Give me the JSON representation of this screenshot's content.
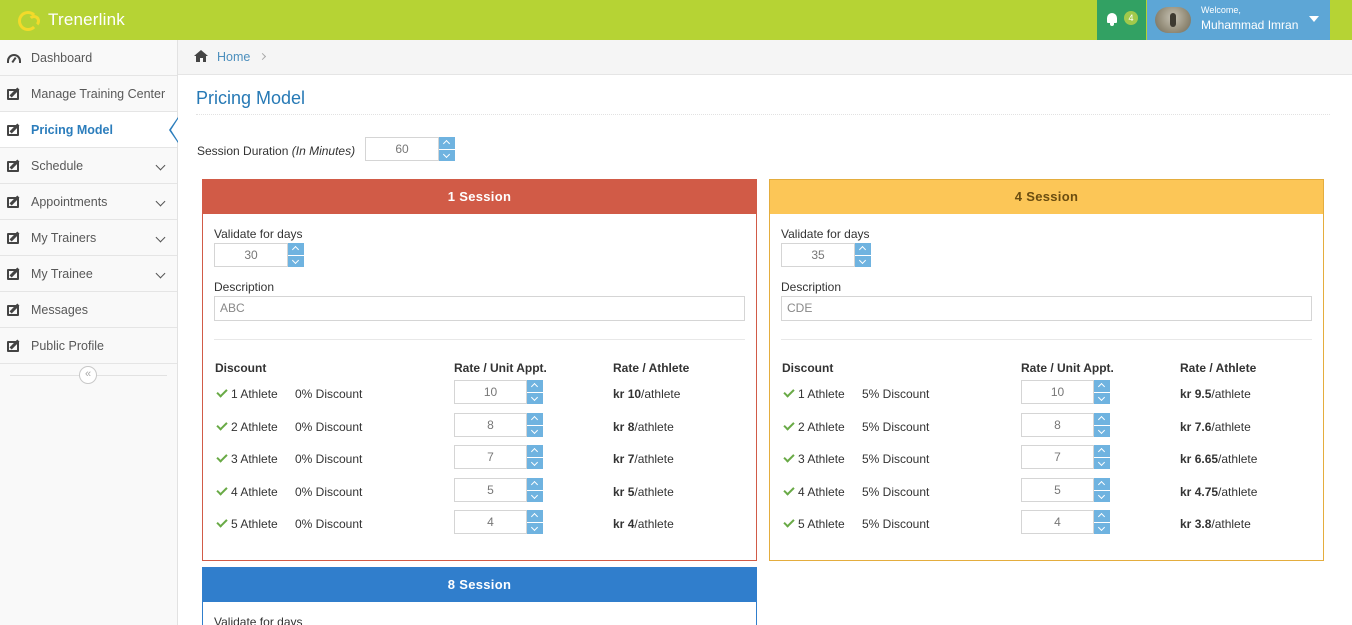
{
  "header": {
    "brand": "Trenerlink",
    "notification_count": "4",
    "welcome": "Welcome,",
    "user_name": "Muhammad Imran"
  },
  "sidebar": {
    "items": [
      {
        "label": "Dashboard",
        "icon": "dashboard-icon",
        "has_children": false,
        "active": false
      },
      {
        "label": "Manage Training Center",
        "icon": "edit-icon",
        "has_children": false,
        "active": false
      },
      {
        "label": "Pricing Model",
        "icon": "edit-icon",
        "has_children": false,
        "active": true
      },
      {
        "label": "Schedule",
        "icon": "edit-icon",
        "has_children": true,
        "active": false
      },
      {
        "label": "Appointments",
        "icon": "edit-icon",
        "has_children": true,
        "active": false
      },
      {
        "label": "My Trainers",
        "icon": "edit-icon",
        "has_children": true,
        "active": false
      },
      {
        "label": "My Trainee",
        "icon": "edit-icon",
        "has_children": true,
        "active": false
      },
      {
        "label": "Messages",
        "icon": "edit-icon",
        "has_children": false,
        "active": false
      },
      {
        "label": "Public Profile",
        "icon": "edit-icon",
        "has_children": false,
        "active": false
      }
    ],
    "collapse_glyph": "«"
  },
  "breadcrumb": {
    "home": "Home"
  },
  "page": {
    "title": "Pricing Model",
    "session_duration_label": "Session Duration",
    "session_duration_unit": "(In Minutes)",
    "session_duration_value": "60"
  },
  "colors": {
    "header_bg": "#b6d334",
    "notif_bg": "#32a163",
    "user_bg": "#5da6d6",
    "accent": "#2b7dbc",
    "panel_red": "#d15b47",
    "panel_yellow": "#fcc657",
    "panel_blue": "#307ecc"
  },
  "labels": {
    "validate": "Validate for days",
    "description": "Description",
    "discount": "Discount",
    "rate_unit": "Rate / Unit Appt.",
    "rate_athlete": "Rate / Athlete",
    "currency": "kr",
    "per_athlete": "/athlete"
  },
  "packages": [
    {
      "title": "1 Session",
      "validate_days": "30",
      "description": "ABC",
      "rows": [
        {
          "athletes": "1 Athlete",
          "discount": "0% Discount",
          "rate_unit": "10",
          "rate_athlete": "10"
        },
        {
          "athletes": "2 Athlete",
          "discount": "0% Discount",
          "rate_unit": "8",
          "rate_athlete": "8"
        },
        {
          "athletes": "3 Athlete",
          "discount": "0% Discount",
          "rate_unit": "7",
          "rate_athlete": "7"
        },
        {
          "athletes": "4 Athlete",
          "discount": "0% Discount",
          "rate_unit": "5",
          "rate_athlete": "5"
        },
        {
          "athletes": "5 Athlete",
          "discount": "0% Discount",
          "rate_unit": "4",
          "rate_athlete": "4"
        }
      ]
    },
    {
      "title": "4 Session",
      "validate_days": "35",
      "description": "CDE",
      "rows": [
        {
          "athletes": "1 Athlete",
          "discount": "5% Discount",
          "rate_unit": "10",
          "rate_athlete": "9.5"
        },
        {
          "athletes": "2 Athlete",
          "discount": "5% Discount",
          "rate_unit": "8",
          "rate_athlete": "7.6"
        },
        {
          "athletes": "3 Athlete",
          "discount": "5% Discount",
          "rate_unit": "7",
          "rate_athlete": "6.65"
        },
        {
          "athletes": "4 Athlete",
          "discount": "5% Discount",
          "rate_unit": "5",
          "rate_athlete": "4.75"
        },
        {
          "athletes": "5 Athlete",
          "discount": "5% Discount",
          "rate_unit": "4",
          "rate_athlete": "3.8"
        }
      ]
    },
    {
      "title": "8 Session"
    }
  ]
}
